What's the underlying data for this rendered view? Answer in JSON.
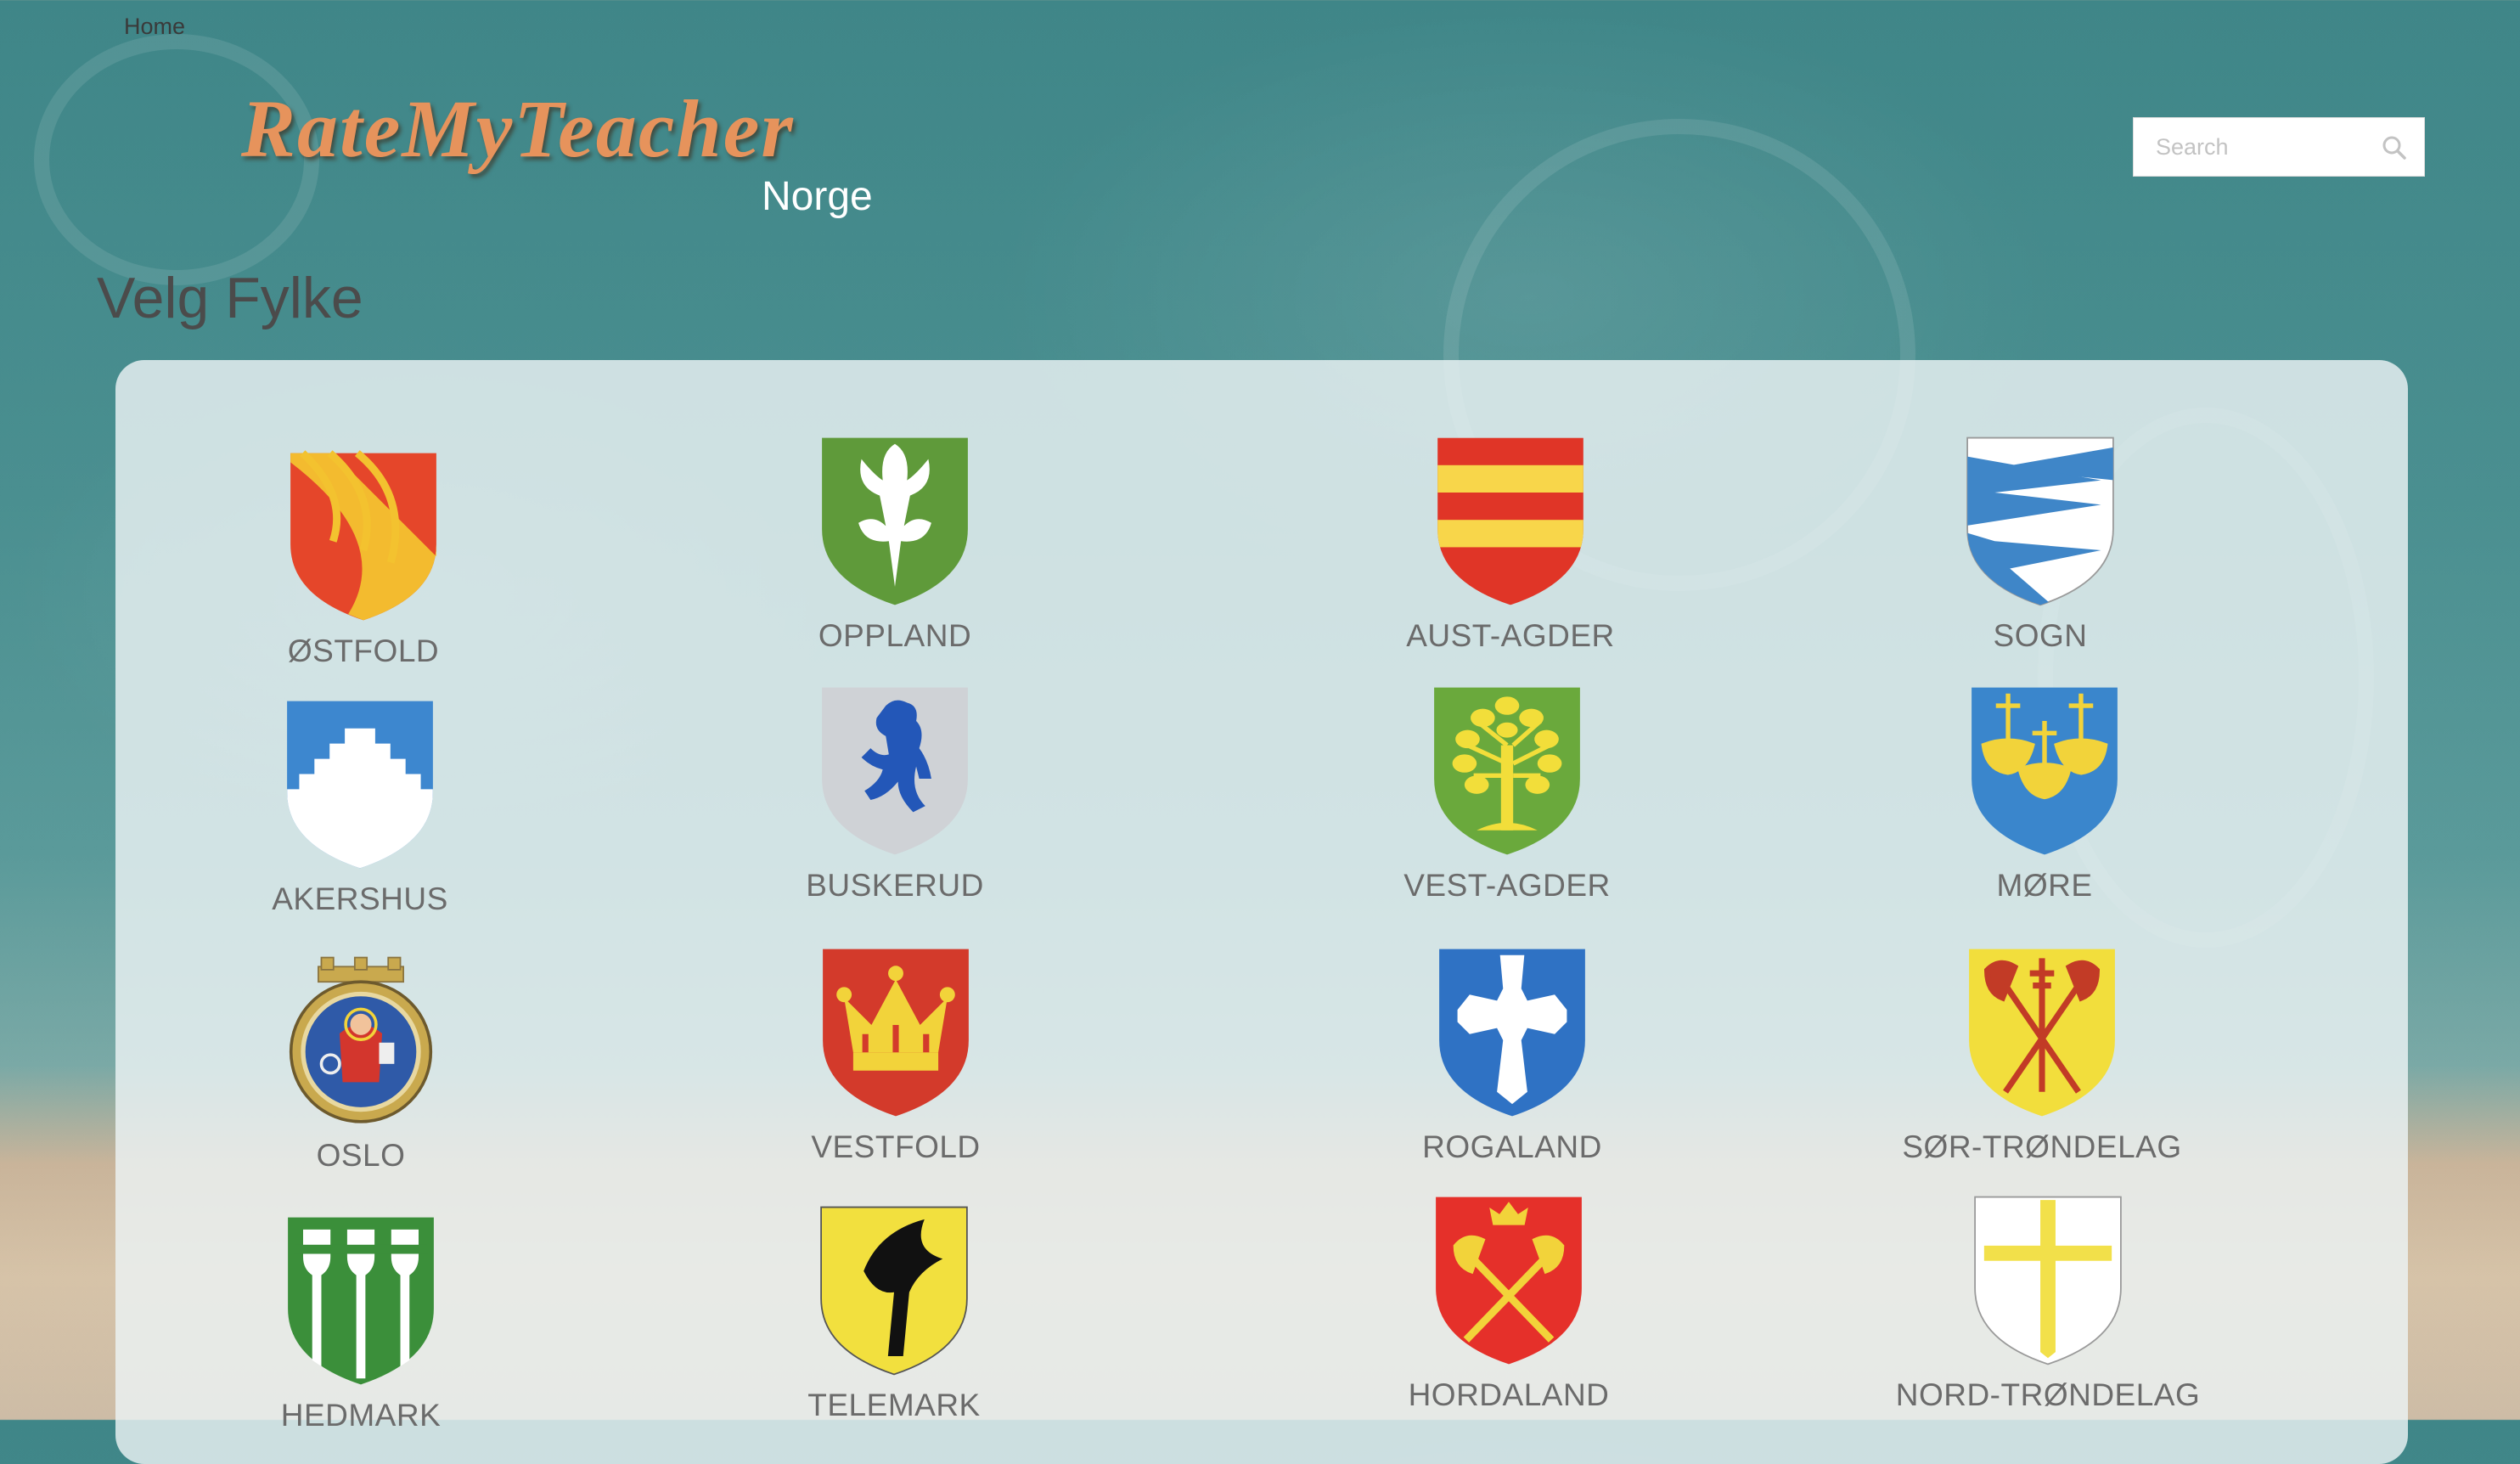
{
  "nav": {
    "home_label": "Home"
  },
  "header": {
    "logo_text": "RateMyTeacher",
    "logo_subtitle": "Norge"
  },
  "search": {
    "placeholder": "Search"
  },
  "page": {
    "title": "Velg Fylke"
  },
  "colors": {
    "logo": "#e6935c",
    "panel": "#ebf3f4",
    "label": "#6b6b6b"
  },
  "counties": [
    {
      "name": "ØSTFOLD",
      "icon": "ostfold-coat-of-arms-icon"
    },
    {
      "name": "OPPLAND",
      "icon": "oppland-coat-of-arms-icon"
    },
    {
      "name": "AUST-AGDER",
      "icon": "aust-agder-coat-of-arms-icon"
    },
    {
      "name": "SOGN",
      "icon": "sogn-coat-of-arms-icon"
    },
    {
      "name": "AKERSHUS",
      "icon": "akershus-coat-of-arms-icon"
    },
    {
      "name": "BUSKERUD",
      "icon": "buskerud-coat-of-arms-icon"
    },
    {
      "name": "VEST-AGDER",
      "icon": "vest-agder-coat-of-arms-icon"
    },
    {
      "name": "MØRE",
      "icon": "more-coat-of-arms-icon"
    },
    {
      "name": "OSLO",
      "icon": "oslo-seal-icon"
    },
    {
      "name": "VESTFOLD",
      "icon": "vestfold-coat-of-arms-icon"
    },
    {
      "name": "ROGALAND",
      "icon": "rogaland-coat-of-arms-icon"
    },
    {
      "name": "SØR-TRØNDELAG",
      "icon": "sor-trondelag-coat-of-arms-icon"
    },
    {
      "name": "HEDMARK",
      "icon": "hedmark-coat-of-arms-icon"
    },
    {
      "name": "TELEMARK",
      "icon": "telemark-coat-of-arms-icon"
    },
    {
      "name": "HORDALAND",
      "icon": "hordaland-coat-of-arms-icon"
    },
    {
      "name": "NORD-TRØNDELAG",
      "icon": "nord-trondelag-coat-of-arms-icon"
    }
  ]
}
